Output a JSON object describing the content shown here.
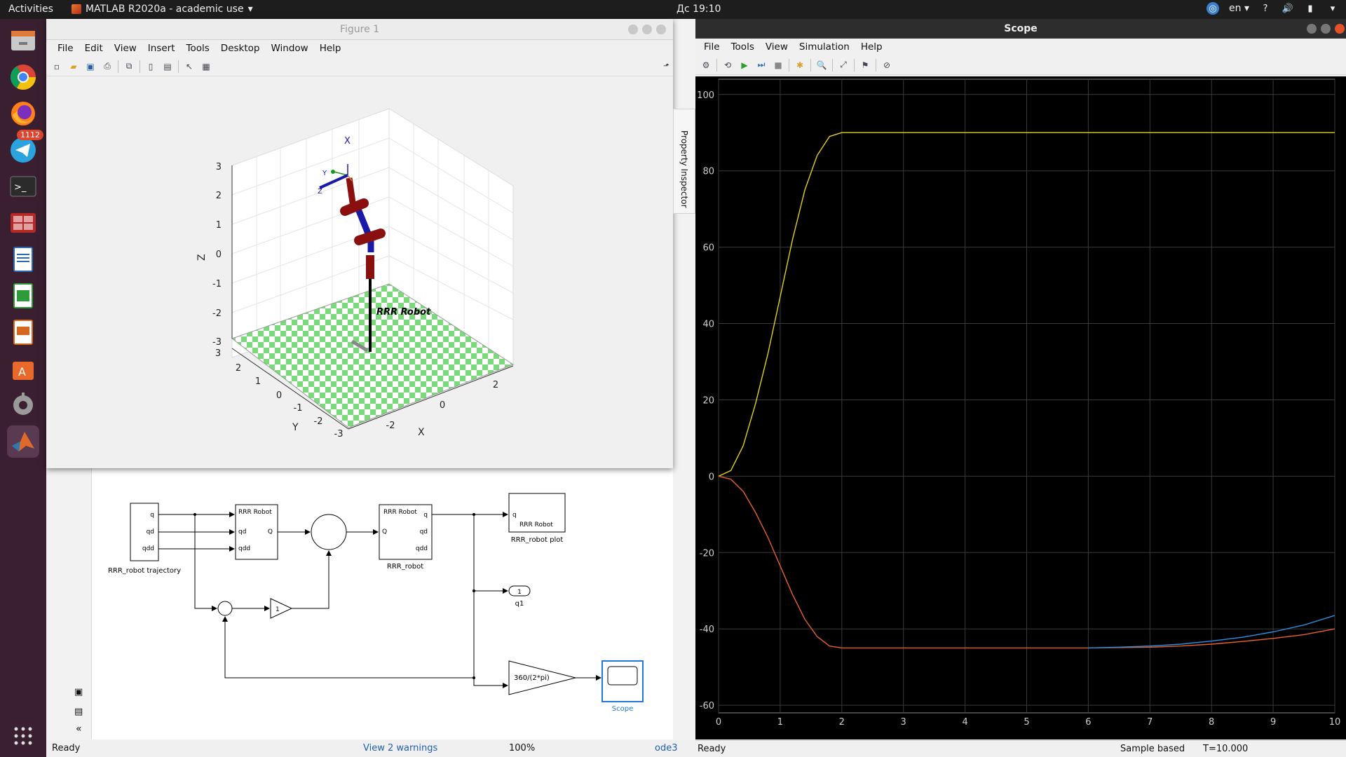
{
  "top_panel": {
    "activities": "Activities",
    "app_menu": "MATLAB R2020a - academic use",
    "clock": "Дс 19:10",
    "language": "en",
    "help": "?"
  },
  "dock": {
    "telegram_badge": "1112"
  },
  "figure": {
    "title": "Figure 1",
    "menu": [
      "File",
      "Edit",
      "View",
      "Insert",
      "Tools",
      "Desktop",
      "Window",
      "Help"
    ],
    "axes": {
      "z_label": "Z",
      "x_label": "X",
      "y_label": "Y",
      "z_ticks": [
        "3",
        "2",
        "1",
        "0",
        "-1",
        "-2",
        "-3"
      ],
      "y_ticks": [
        "3",
        "2",
        "1",
        "0",
        "-1",
        "-2",
        "-3"
      ],
      "x_ticks": [
        "-2",
        "0",
        "2"
      ],
      "robot_name": "RRR Robot",
      "frame_label": "X"
    }
  },
  "property_inspector": "Property Inspector",
  "simulink": {
    "blocks": {
      "trajectory": "RRR_robot trajectory",
      "traj_ports": [
        "q",
        "qd",
        "qdd"
      ],
      "robot_block_title": "RRR Robot",
      "robot_in_ports": [
        "q",
        "qd",
        "qdd"
      ],
      "robot_out_port": "Q",
      "robot2_title": "RRR Robot",
      "robot2_in": "Q",
      "robot2_out_ports": [
        "q",
        "qd",
        "qdd"
      ],
      "robot2_label": "RRR_robot",
      "plot_block_text": "RRR Robot",
      "plot_block_port": "q",
      "plot_label": "RRR_robot plot",
      "outport_value": "1",
      "outport_label": "q1",
      "gain1": "1",
      "gain2": "360/(2*pi)",
      "scope_label": "Scope"
    },
    "status": {
      "ready": "Ready",
      "warnings": "View 2 warnings",
      "zoom": "100%",
      "solver": "ode3"
    }
  },
  "scope": {
    "title": "Scope",
    "menu": [
      "File",
      "Tools",
      "View",
      "Simulation",
      "Help"
    ],
    "status_ready": "Ready",
    "status_mode": "Sample based",
    "status_time": "T=10.000"
  },
  "chart_data": {
    "type": "line",
    "x_ticks": [
      "0",
      "1",
      "2",
      "3",
      "4",
      "5",
      "6",
      "7",
      "8",
      "9",
      "10"
    ],
    "y_ticks": [
      "100",
      "80",
      "60",
      "40",
      "20",
      "0",
      "-20",
      "-40",
      "-60"
    ],
    "xlim": [
      0,
      10
    ],
    "ylim": [
      -62,
      104
    ],
    "grid": true,
    "colors": {
      "background": "#000000",
      "grid": "#3a3a3a",
      "tick_text": "#cfcfcf"
    },
    "series": [
      {
        "color": "#e3d21a",
        "x": [
          0,
          0.2,
          0.4,
          0.6,
          0.8,
          1.0,
          1.2,
          1.4,
          1.6,
          1.8,
          2.0,
          3,
          4,
          5,
          6,
          7,
          8,
          9,
          10
        ],
        "y": [
          0,
          1.5,
          8,
          19,
          32,
          47,
          62,
          75,
          84,
          89,
          90,
          90,
          90,
          90,
          90,
          90,
          90,
          90,
          90
        ]
      },
      {
        "color": "#e8612c",
        "x": [
          0,
          0.2,
          0.4,
          0.6,
          0.8,
          1.0,
          1.2,
          1.4,
          1.6,
          1.8,
          2.0,
          3,
          4,
          5,
          6,
          7,
          7.5,
          8,
          8.5,
          9,
          9.5,
          10
        ],
        "y": [
          0,
          -0.8,
          -4,
          -9.5,
          -16,
          -23.5,
          -31,
          -37.5,
          -42,
          -44.5,
          -45,
          -45,
          -45,
          -45,
          -45,
          -44.8,
          -44.5,
          -44,
          -43.3,
          -42.5,
          -41.5,
          -40
        ]
      },
      {
        "color": "#2a90e0",
        "x": [
          6,
          6.5,
          7,
          7.5,
          8,
          8.5,
          9,
          9.5,
          10
        ],
        "y": [
          -45,
          -44.8,
          -44.5,
          -44,
          -43.2,
          -42.2,
          -40.8,
          -39,
          -36.5
        ]
      }
    ]
  }
}
